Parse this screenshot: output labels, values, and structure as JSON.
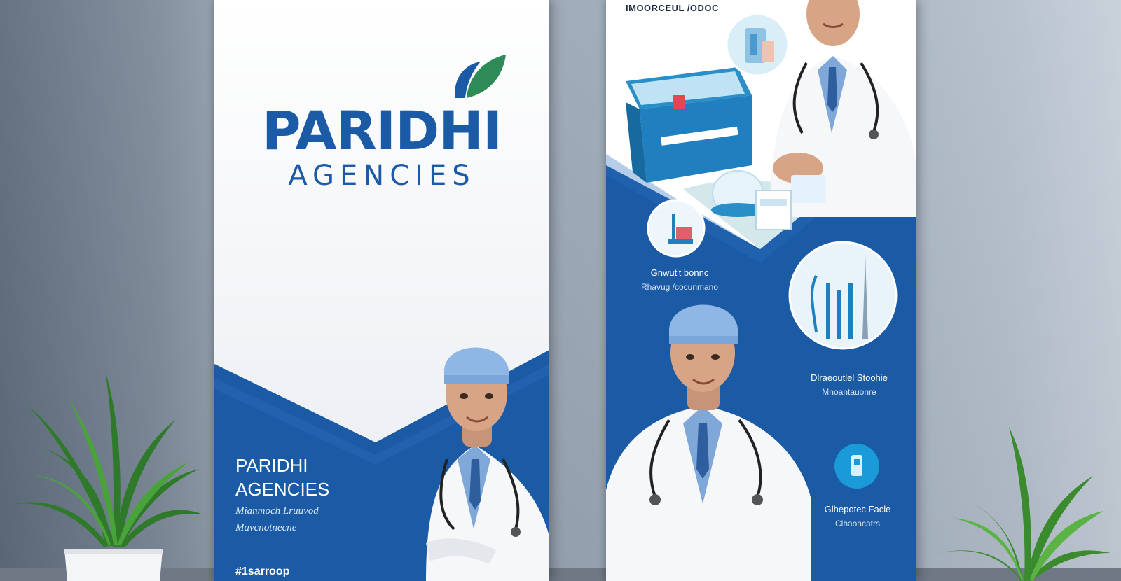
{
  "left_banner": {
    "brand_title": "PARIDHI",
    "brand_subtitle": "AGENCIES",
    "footer_name_line1": "PARIDHI",
    "footer_name_line2": "AGENCIES",
    "tagline_line1": "Mianmoch Lruuvod",
    "tagline_line2": "Mavcnotnecne",
    "hashtag": "#1sarroop",
    "colors": {
      "brand_blue": "#1b5aa5",
      "leaf_green": "#2e8b57",
      "leaf_blue": "#1b5aa5"
    }
  },
  "right_banner": {
    "top_label": "IMOORCEUL /ODOC",
    "features": [
      {
        "line1": "Gnwut't bonnc",
        "line2": "Rhavug /cocunmano"
      },
      {
        "line1": "Dlraeoutlel Stoohie",
        "line2": "Mnoantauonre"
      },
      {
        "line1": "Glhepotec Facle",
        "line2": "Clhaoacatrs"
      }
    ],
    "colors": {
      "panel_blue": "#1b5aa5",
      "accent_cyan": "#1a9ad6"
    }
  }
}
